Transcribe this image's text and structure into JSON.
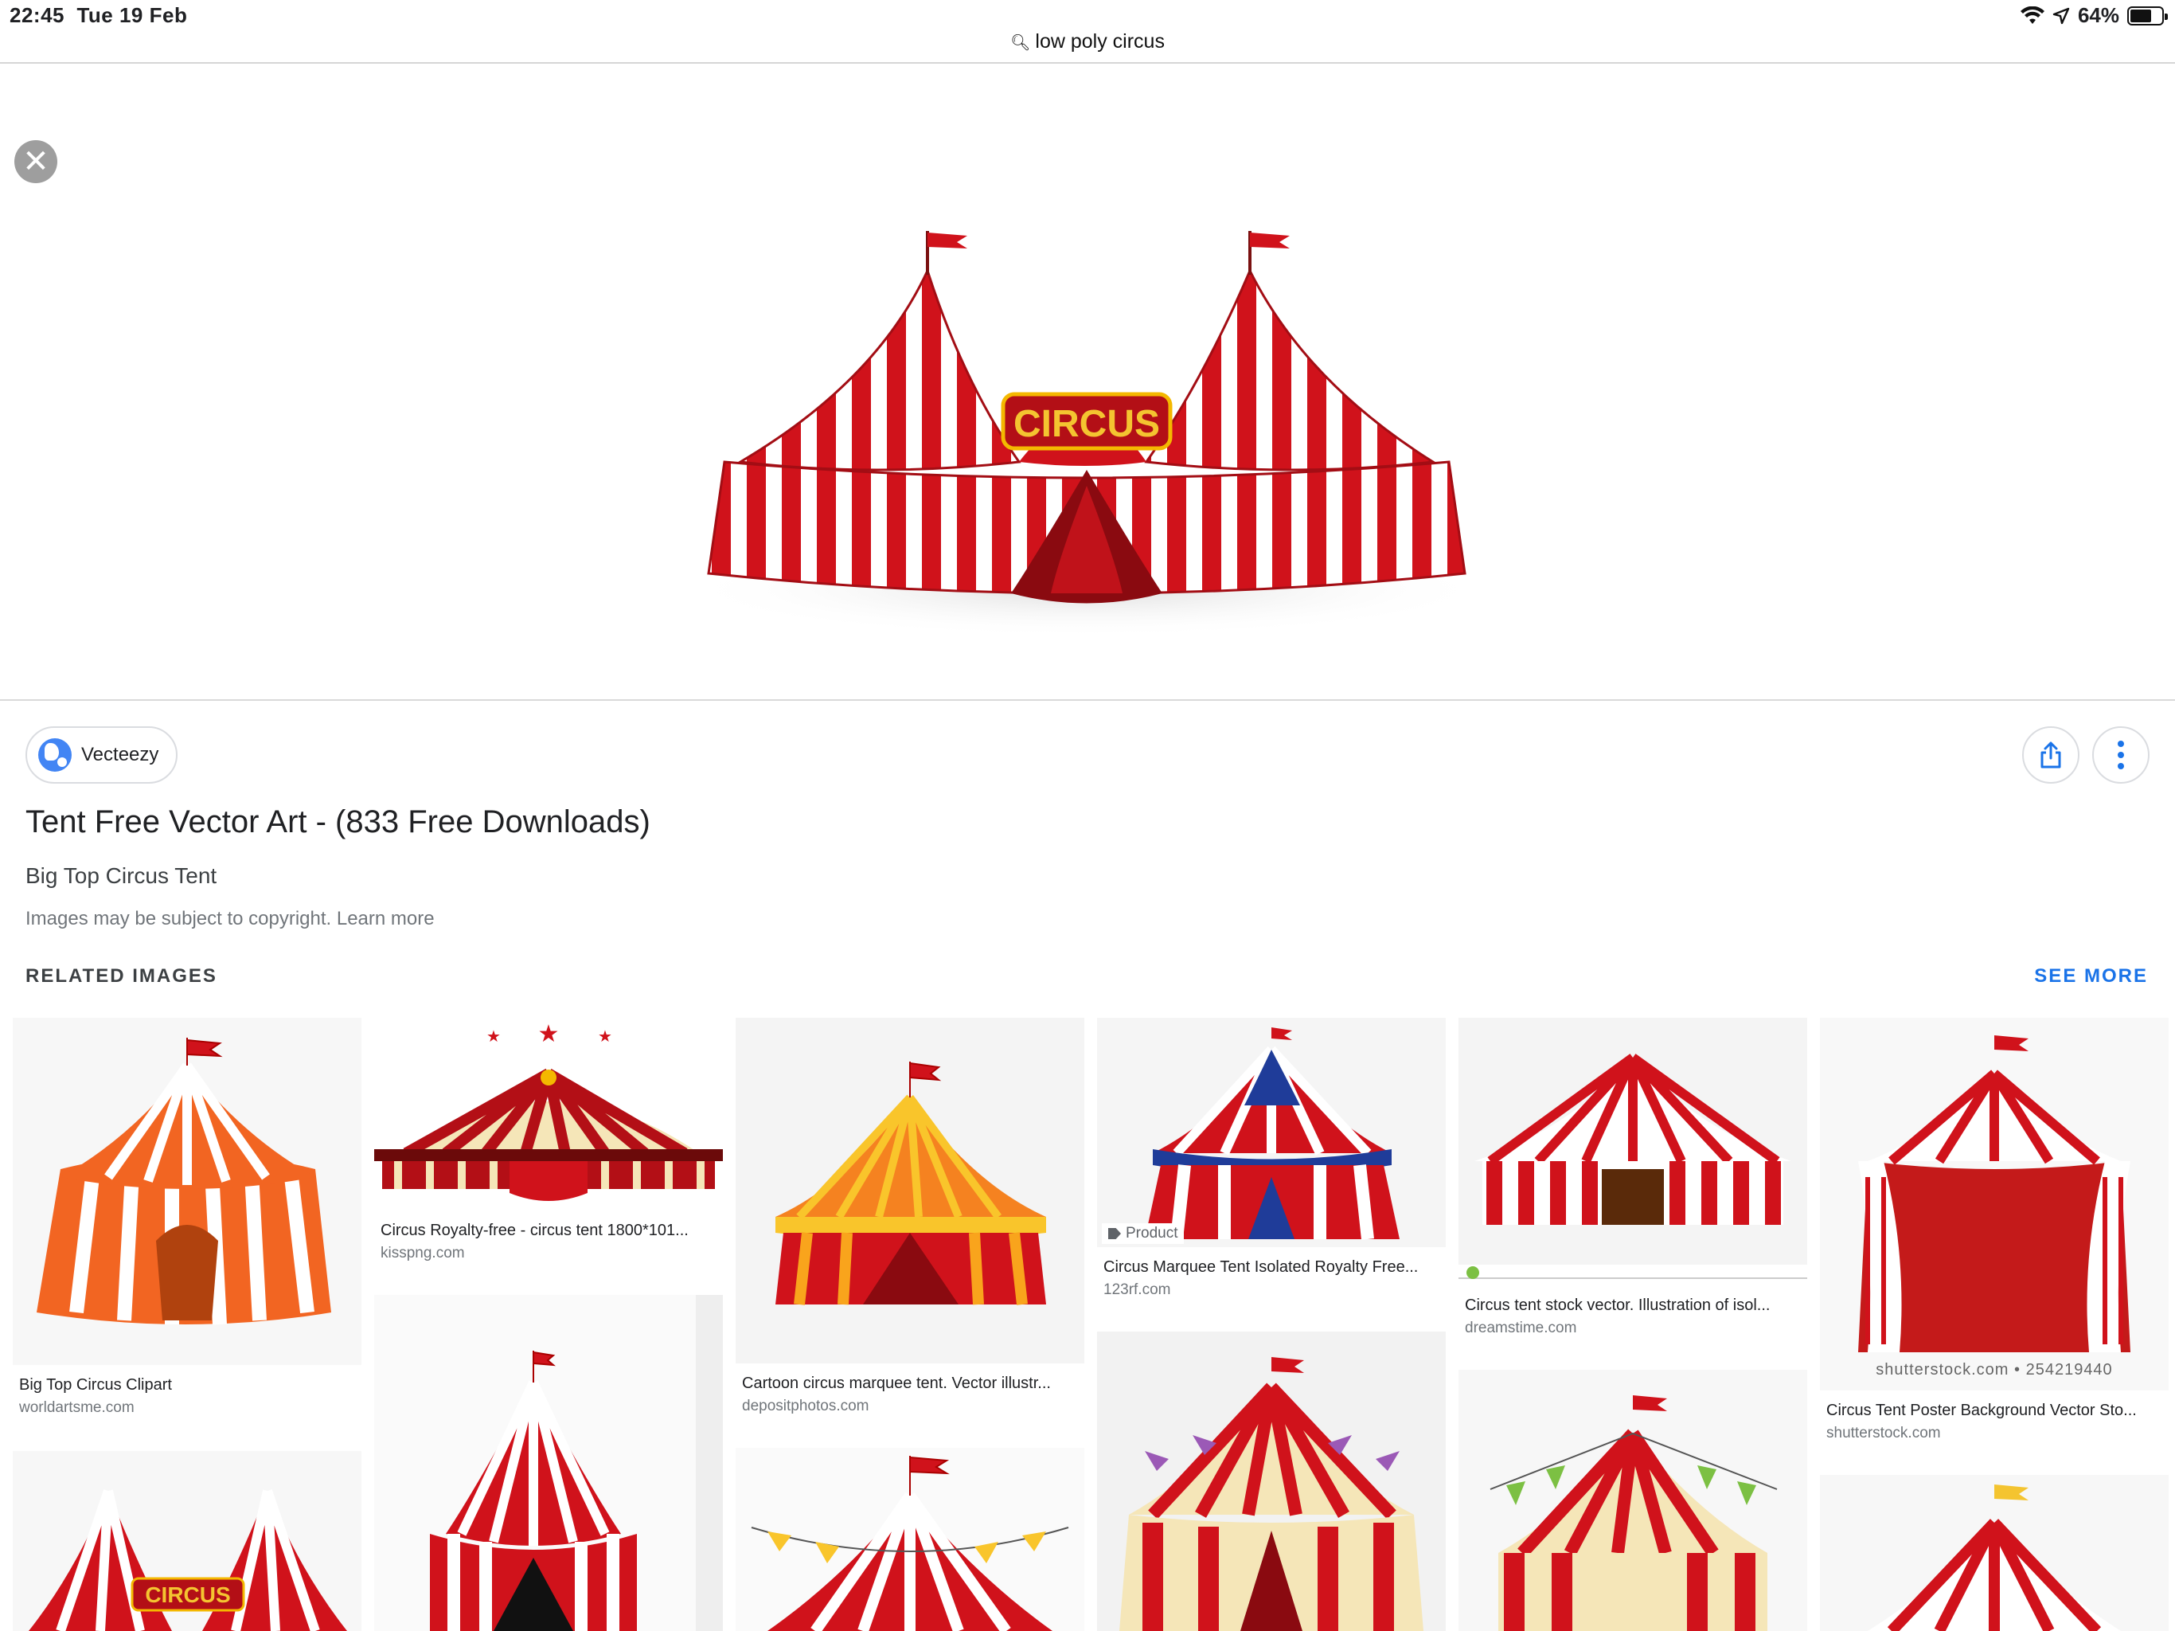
{
  "status_bar": {
    "time": "22:45",
    "date": "Tue 19 Feb",
    "battery": "64%",
    "battery_level": 0.64
  },
  "address_bar": {
    "query": "low poly circus"
  },
  "hero": {
    "sign_text": "CIRCUS"
  },
  "result": {
    "source": "Vecteezy",
    "title": "Tent Free Vector Art - (833 Free Downloads)",
    "subtitle": "Big Top Circus Tent",
    "copyright": "Images may be subject to copyright. Learn more"
  },
  "related": {
    "heading": "RELATED IMAGES",
    "see_more": "SEE MORE",
    "items": [
      {
        "caption": "Big Top Circus Clipart",
        "domain": "worldartsme.com"
      },
      {
        "caption": "Circus Royalty-free - circus tent 1800*101...",
        "domain": "kisspng.com"
      },
      {
        "caption": "Cartoon circus marquee tent. Vector illustr...",
        "domain": "depositphotos.com"
      },
      {
        "caption": "Circus Marquee Tent Isolated Royalty Free...",
        "domain": "123rf.com",
        "badge": "Product"
      },
      {
        "caption": "Circus tent stock vector. Illustration of isol...",
        "domain": "dreamstime.com"
      },
      {
        "caption": "Circus Tent Poster Background Vector Sto...",
        "domain": "shutterstock.com",
        "watermark": "shutterstock.com • 254219440"
      }
    ],
    "lower_watermark": "CIRCUS"
  },
  "colors": {
    "accent": "#1a73e8",
    "tent_red": "#d0121b",
    "tent_white": "#ffffff",
    "tent_orange": "#f26522",
    "tent_cream": "#f5e6b8"
  }
}
